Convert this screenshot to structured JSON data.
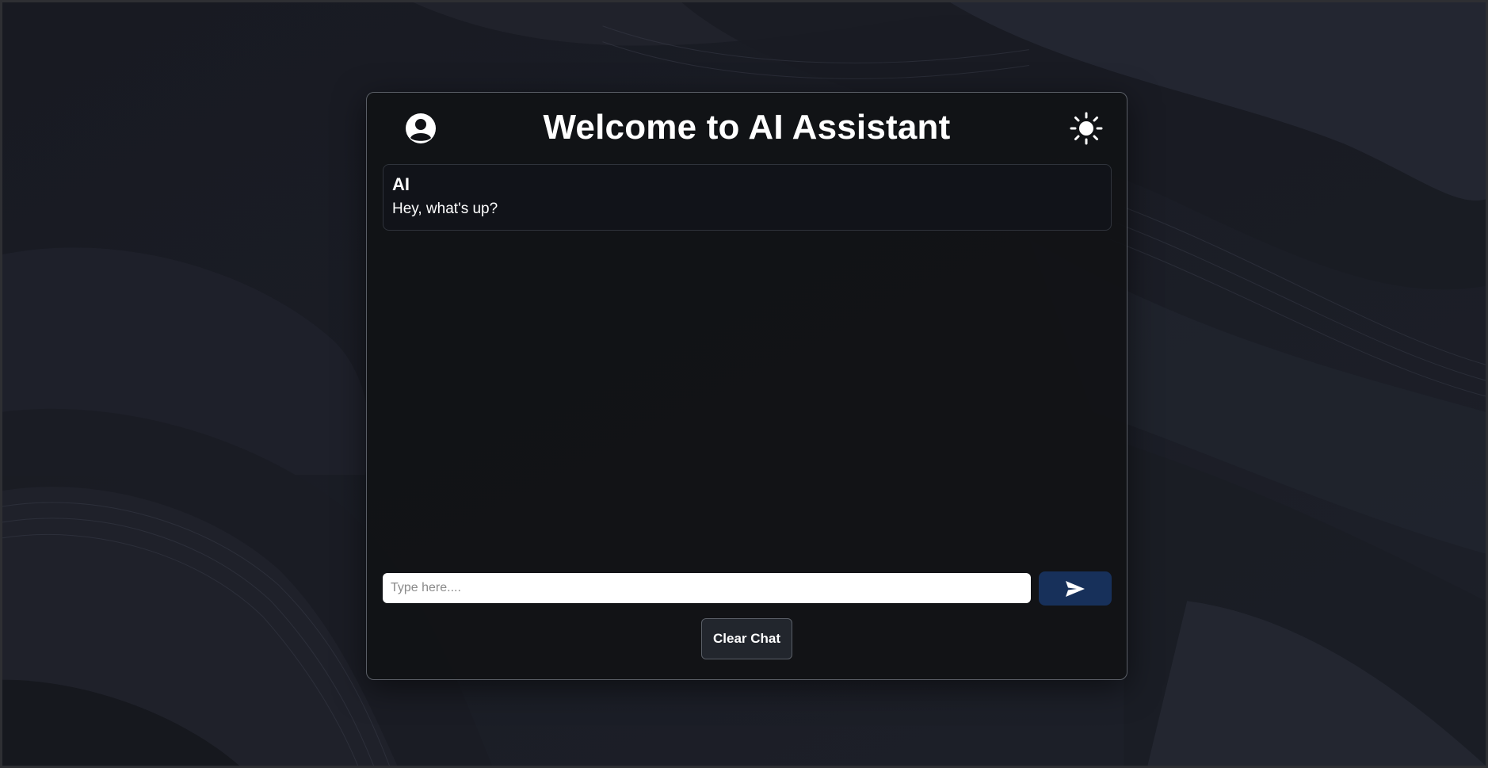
{
  "header": {
    "title": "Welcome to AI Assistant",
    "profile_icon": "user-circle-icon",
    "theme_icon": "sun-icon"
  },
  "messages": [
    {
      "sender": "AI",
      "text": "Hey, what's up?"
    }
  ],
  "composer": {
    "placeholder": "Type here....",
    "value": "",
    "send_icon": "paper-plane-icon"
  },
  "actions": {
    "clear_label": "Clear Chat"
  },
  "colors": {
    "background": "#15171f",
    "card": "#111216",
    "send_button": "#17305a",
    "clear_button": "#22262d",
    "text": "#ffffff"
  }
}
